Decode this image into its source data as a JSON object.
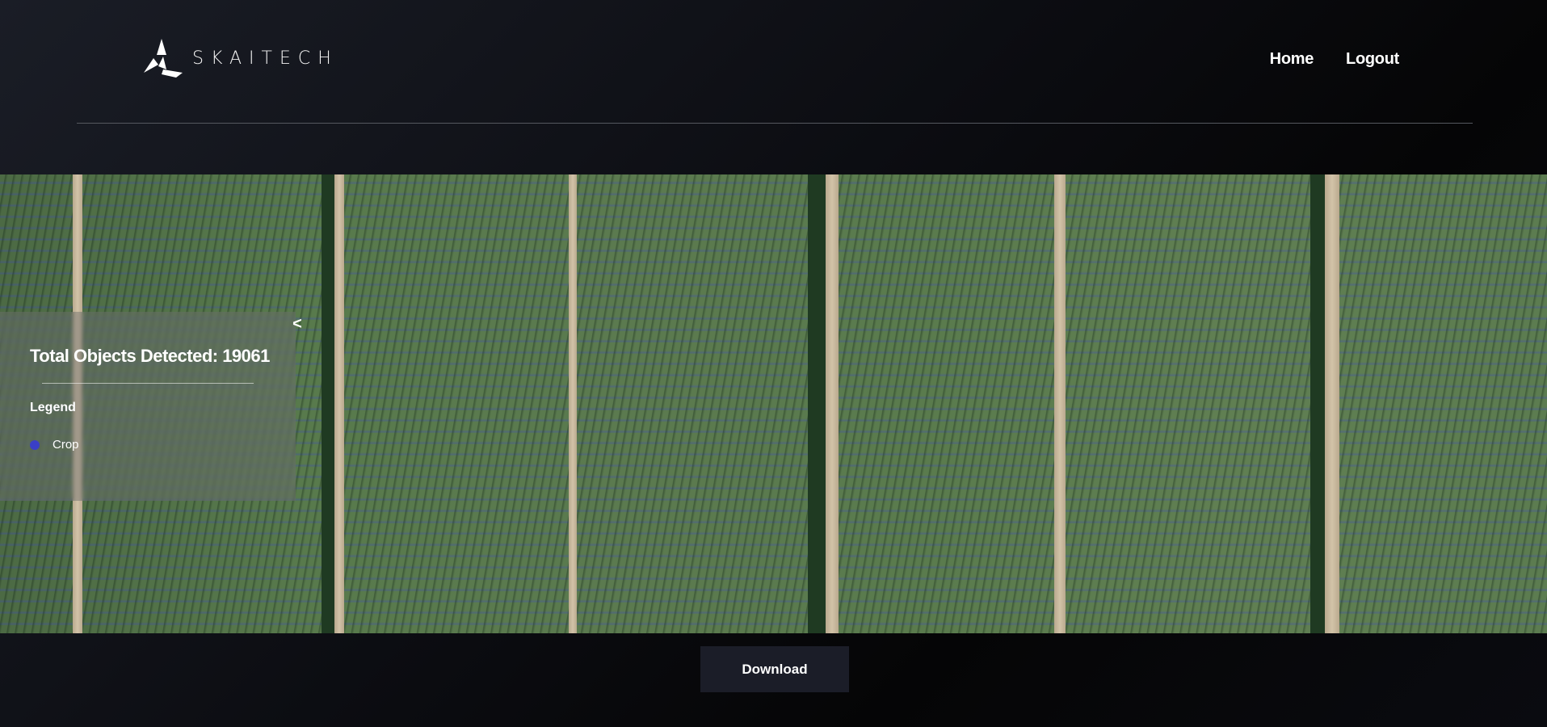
{
  "brand": {
    "name": "SKAITECH"
  },
  "nav": {
    "home": "Home",
    "logout": "Logout"
  },
  "detection": {
    "total_label": "Total Objects Detected: 19061",
    "legend_title": "Legend",
    "legend_items": [
      {
        "label": "Crop",
        "color": "#3a3fc8"
      }
    ],
    "collapse_symbol": "<"
  },
  "actions": {
    "download_label": "Download"
  },
  "colors": {
    "accent": "#3a3fc8",
    "button_bg": "#1b1d28"
  }
}
